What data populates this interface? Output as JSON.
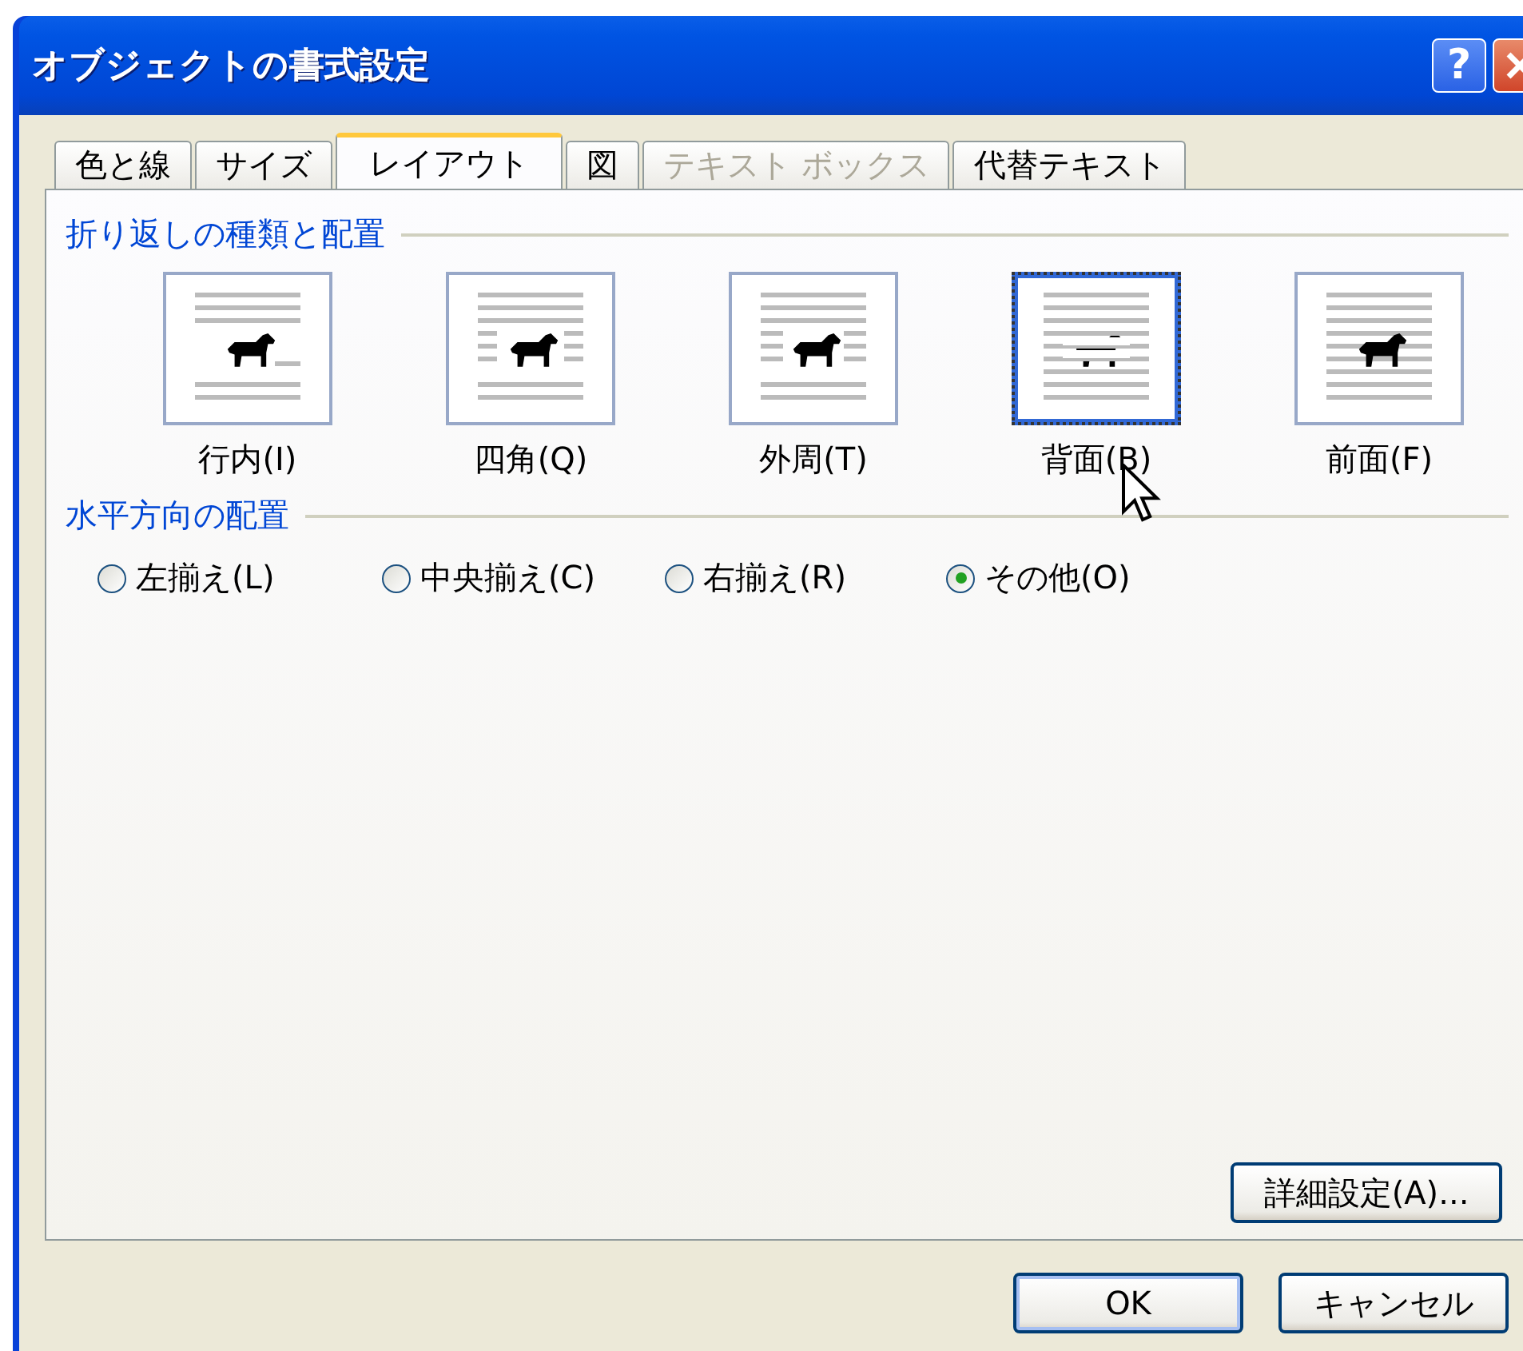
{
  "window": {
    "title": "オブジェクトの書式設定",
    "help_button": "?"
  },
  "tabs": [
    {
      "label": "色と線",
      "selected": false,
      "disabled": false
    },
    {
      "label": "サイズ",
      "selected": false,
      "disabled": false
    },
    {
      "label": "レイアウト",
      "selected": true,
      "disabled": false
    },
    {
      "label": "図",
      "selected": false,
      "disabled": false
    },
    {
      "label": "テキスト ボックス",
      "selected": false,
      "disabled": true
    },
    {
      "label": "代替テキスト",
      "selected": false,
      "disabled": false
    }
  ],
  "wrap_group": {
    "title": "折り返しの種類と配置",
    "options": [
      {
        "label": "行内(I)",
        "kind": "inline",
        "selected": false
      },
      {
        "label": "四角(Q)",
        "kind": "square",
        "selected": false
      },
      {
        "label": "外周(T)",
        "kind": "tight",
        "selected": false
      },
      {
        "label": "背面(B)",
        "kind": "behind",
        "selected": true
      },
      {
        "label": "前面(F)",
        "kind": "front",
        "selected": false
      }
    ]
  },
  "align_group": {
    "title": "水平方向の配置",
    "options": [
      {
        "label": "左揃え(L)",
        "selected": false
      },
      {
        "label": "中央揃え(C)",
        "selected": false
      },
      {
        "label": "右揃え(R)",
        "selected": false
      },
      {
        "label": "その他(O)",
        "selected": true
      }
    ]
  },
  "advanced_button": "詳細設定(A)...",
  "buttons": [
    {
      "label": "OK",
      "kind": "default"
    },
    {
      "label": "キャンセル",
      "kind": "normal"
    }
  ]
}
